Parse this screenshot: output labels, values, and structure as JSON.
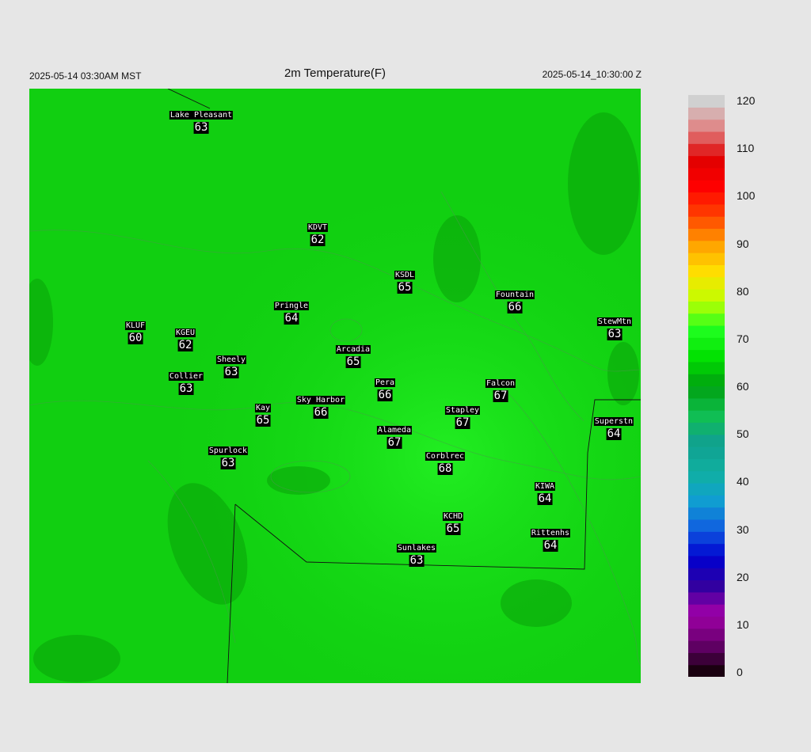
{
  "header": {
    "left": "2025-05-14 03:30AM MST",
    "title": "2m Temperature(F)",
    "right": "2025-05-14_10:30:00 Z"
  },
  "colorbar": {
    "ticks": [
      "0",
      "10",
      "20",
      "30",
      "40",
      "50",
      "60",
      "70",
      "80",
      "90",
      "100",
      "110",
      "120"
    ],
    "stops": [
      "#1a0010",
      "#6a0070",
      "#a000a8",
      "#3000a0",
      "#0000d0",
      "#1060e0",
      "#10a0d0",
      "#10b0a0",
      "#10a090",
      "#10c050",
      "#00a010",
      "#00e000",
      "#20ff20",
      "#c0ff00",
      "#ffe000",
      "#ffa000",
      "#ff4000",
      "#ff0000",
      "#e00000",
      "#e08080",
      "#d0d0d0"
    ]
  },
  "stations": [
    {
      "name": "Lake Pleasant",
      "value": "63"
    },
    {
      "name": "KDVT",
      "value": "62"
    },
    {
      "name": "KSDL",
      "value": "65"
    },
    {
      "name": "Fountain",
      "value": "66"
    },
    {
      "name": "Pringle",
      "value": "64"
    },
    {
      "name": "KLUF",
      "value": "60"
    },
    {
      "name": "KGEU",
      "value": "62"
    },
    {
      "name": "StewMtn",
      "value": "63"
    },
    {
      "name": "Arcadia",
      "value": "65"
    },
    {
      "name": "Sheely",
      "value": "63"
    },
    {
      "name": "Collier",
      "value": "63"
    },
    {
      "name": "Pera",
      "value": "66"
    },
    {
      "name": "Falcon",
      "value": "67"
    },
    {
      "name": "Sky Harbor",
      "value": "66"
    },
    {
      "name": "Kay",
      "value": "65"
    },
    {
      "name": "Stapley",
      "value": "67"
    },
    {
      "name": "Superstn",
      "value": "64"
    },
    {
      "name": "Alameda",
      "value": "67"
    },
    {
      "name": "Spurlock",
      "value": "63"
    },
    {
      "name": "Corblrec",
      "value": "68"
    },
    {
      "name": "KIWA",
      "value": "64"
    },
    {
      "name": "KCHD",
      "value": "65"
    },
    {
      "name": "Rittenhs",
      "value": "64"
    },
    {
      "name": "Sunlakes",
      "value": "63"
    }
  ]
}
